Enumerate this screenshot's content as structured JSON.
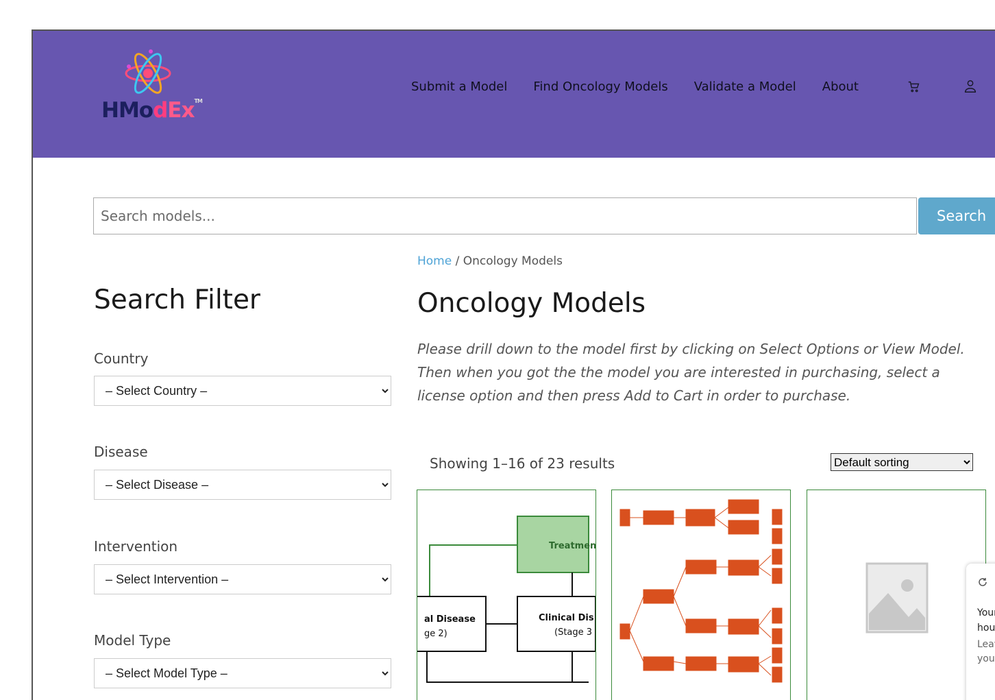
{
  "brand": {
    "logo_name": "HModEx logo",
    "text_1": "HMo",
    "text_2": "d",
    "text_3": "Ex",
    "tm": "TM"
  },
  "nav": {
    "items": [
      "Submit a Model",
      "Find Oncology Models",
      "Validate a Model",
      "About"
    ],
    "icons": [
      "cart-icon",
      "user-icon"
    ]
  },
  "search": {
    "placeholder": "Search models...",
    "button": "Search"
  },
  "filters": {
    "title": "Search Filter",
    "fields": [
      {
        "label": "Country",
        "value": "– Select Country –"
      },
      {
        "label": "Disease",
        "value": "– Select Disease –"
      },
      {
        "label": "Intervention",
        "value": "– Select Intervention –"
      },
      {
        "label": "Model Type",
        "value": "– Select Model Type –"
      }
    ]
  },
  "breadcrumb": {
    "home": "Home",
    "sep": " / ",
    "current": "Oncology Models"
  },
  "main": {
    "title": "Oncology Models",
    "intro": "Please drill down to the model first by clicking on Select Options or View Model. Then when you got the the model you are interested in purchasing, select a license option and then press Add to Cart in order to purchase.",
    "result_count": "Showing 1–16 of 23 results",
    "sort_value": "Default sorting"
  },
  "cards": {
    "c1": {
      "treat": "Treatmen",
      "disease_a": "al Disease",
      "stage_a": "ge 2)",
      "disease_b": "Clinical Dis",
      "stage_b": "(Stage 3"
    }
  },
  "popup": {
    "l1": "Your",
    "l2": "hou",
    "l3": "Leav",
    "l4": "your"
  },
  "colors": {
    "header": "#6756b0",
    "accent": "#5fa8cc",
    "card_border": "#3a8a3a",
    "flow_orange": "#d9501e"
  }
}
